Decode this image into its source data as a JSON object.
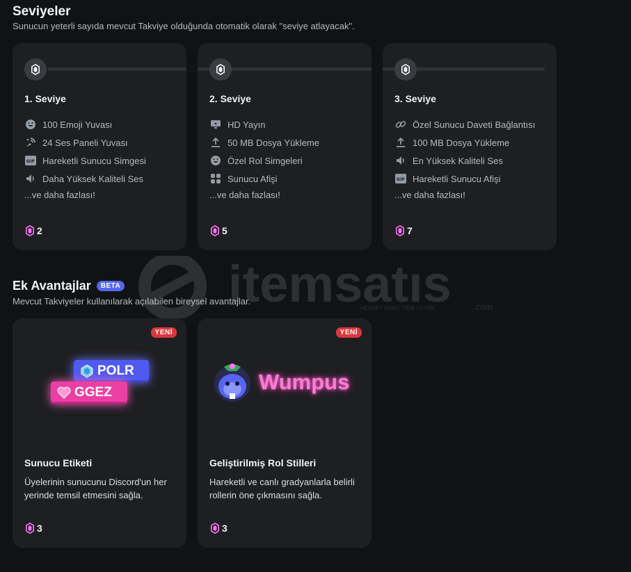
{
  "levels_section": {
    "title": "Seviyeler",
    "subtitle": "Sunucun yeterli sayıda mevcut Takviye olduğunda otomatik olarak \"seviye atlayacak\"."
  },
  "levels": [
    {
      "title": "1. Seviye",
      "features": [
        {
          "icon": "emoji-icon",
          "label": "100 Emoji Yuvası"
        },
        {
          "icon": "soundboard-icon",
          "label": "24 Ses Paneli Yuvası"
        },
        {
          "icon": "gif-icon",
          "label": "Hareketli Sunucu Simgesi"
        },
        {
          "icon": "speaker-icon",
          "label": "Daha Yüksek Kaliteli Ses"
        }
      ],
      "more": "...ve daha fazlası!",
      "boosts": "2"
    },
    {
      "title": "2. Seviye",
      "features": [
        {
          "icon": "screen-share-icon",
          "label": "HD Yayın"
        },
        {
          "icon": "upload-icon",
          "label": "50 MB Dosya Yükleme"
        },
        {
          "icon": "emoji-icon",
          "label": "Özel Rol Simgeleri"
        },
        {
          "icon": "grid-icon",
          "label": "Sunucu Afişi"
        }
      ],
      "more": "...ve daha fazlası!",
      "boosts": "5"
    },
    {
      "title": "3. Seviye",
      "features": [
        {
          "icon": "link-icon",
          "label": "Özel Sunucu Daveti Bağlantısı"
        },
        {
          "icon": "upload-icon",
          "label": "100 MB Dosya Yükleme"
        },
        {
          "icon": "speaker-icon",
          "label": "En Yüksek Kaliteli Ses"
        },
        {
          "icon": "gif-icon",
          "label": "Hareketli Sunucu Afişi"
        }
      ],
      "more": "...ve daha fazlası!",
      "boosts": "7"
    }
  ],
  "perks_section": {
    "title": "Ek Avantajlar",
    "beta_label": "BETA",
    "subtitle": "Mevcut Takviyeler kullanılarak açılabilen bireysel avantajlar."
  },
  "perks": [
    {
      "new_label": "YENİ",
      "title": "Sunucu Etiketi",
      "description": "Üyelerinin sunucunu Discord'un her yerinde temsil etmesini sağla.",
      "boosts": "3",
      "preview": {
        "tag_1": "POLR",
        "tag_2": "GGEZ"
      }
    },
    {
      "new_label": "YENİ",
      "title": "Geliştirilmiş Rol Stilleri",
      "description": "Hareketli ve canlı gradyanlarla belirli rollerin öne çıkmasını sağla.",
      "boosts": "3",
      "preview": {
        "name": "Wumpus"
      }
    }
  ],
  "watermark": {
    "brand": "itemsatıs",
    "tagline": "HESAP / SKIN / ITEM / E-PIN",
    "suffix": ".com"
  },
  "colors": {
    "boost_pink": "#ff73fa",
    "beta_blue": "#5865f2",
    "new_red": "#da373c",
    "card_bg": "#1e1f22"
  }
}
